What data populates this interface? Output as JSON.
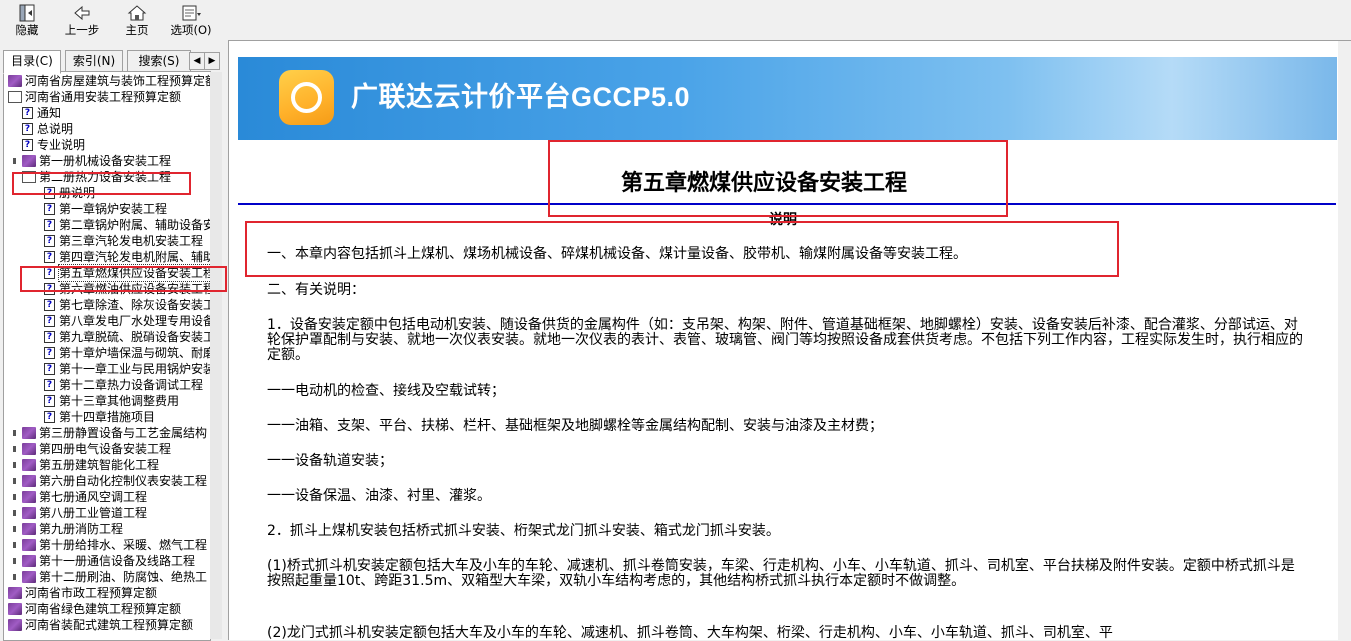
{
  "toolbar": {
    "buttons": [
      {
        "label": "隐藏",
        "icon": "hide-icon"
      },
      {
        "label": "上一步",
        "icon": "back-arrow-icon"
      },
      {
        "label": "主页",
        "icon": "home-icon"
      },
      {
        "label": "选项(O)",
        "icon": "options-icon"
      }
    ]
  },
  "tabs": [
    {
      "label": "目录(C)",
      "active": true
    },
    {
      "label": "索引(N)",
      "active": false
    },
    {
      "label": "搜索(S)",
      "active": false
    }
  ],
  "tree": [
    {
      "label": "河南省房屋建筑与装饰工程预算定额",
      "icon": "book-icon",
      "level": 0
    },
    {
      "label": "河南省通用安装工程预算定额",
      "icon": "open-book-icon",
      "level": 0
    },
    {
      "label": "通知",
      "icon": "help-page-icon",
      "level": 1
    },
    {
      "label": "总说明",
      "icon": "help-page-icon",
      "level": 1
    },
    {
      "label": "专业说明",
      "icon": "help-page-icon",
      "level": 1
    },
    {
      "label": "第一册机械设备安装工程",
      "icon": "book-icon",
      "level": 1
    },
    {
      "label": "第二册热力设备安装工程",
      "icon": "open-book-icon",
      "level": 1
    },
    {
      "label": "册说明",
      "icon": "help-page-icon",
      "level": 2
    },
    {
      "label": "第一章锅炉安装工程",
      "icon": "help-page-icon",
      "level": 2
    },
    {
      "label": "第二章锅炉附属、辅助设备安",
      "icon": "help-page-icon",
      "level": 2
    },
    {
      "label": "第三章汽轮发电机安装工程",
      "icon": "help-page-icon",
      "level": 2
    },
    {
      "label": "第四章汽轮发电机附属、辅助",
      "icon": "help-page-icon",
      "level": 2
    },
    {
      "label": "第五章燃煤供应设备安装工程",
      "icon": "help-page-icon",
      "level": 2,
      "selected": true
    },
    {
      "label": "第六章燃油供应设备安装工程",
      "icon": "help-page-icon",
      "level": 2
    },
    {
      "label": "第七章除渣、除灰设备安装工",
      "icon": "help-page-icon",
      "level": 2
    },
    {
      "label": "第八章发电厂水处理专用设备",
      "icon": "help-page-icon",
      "level": 2
    },
    {
      "label": "第九章脱硫、脱硝设备安装工",
      "icon": "help-page-icon",
      "level": 2
    },
    {
      "label": "第十章炉墙保温与砌筑、耐磨",
      "icon": "help-page-icon",
      "level": 2
    },
    {
      "label": "第十一章工业与民用锅炉安装",
      "icon": "help-page-icon",
      "level": 2
    },
    {
      "label": "第十二章热力设备调试工程",
      "icon": "help-page-icon",
      "level": 2
    },
    {
      "label": "第十三章其他调整费用",
      "icon": "help-page-icon",
      "level": 2
    },
    {
      "label": "第十四章措施项目",
      "icon": "help-page-icon",
      "level": 2
    },
    {
      "label": "第三册静置设备与工艺金属结构",
      "icon": "book-icon",
      "level": 1
    },
    {
      "label": "第四册电气设备安装工程",
      "icon": "book-icon",
      "level": 1
    },
    {
      "label": "第五册建筑智能化工程",
      "icon": "book-icon",
      "level": 1
    },
    {
      "label": "第六册自动化控制仪表安装工程",
      "icon": "book-icon",
      "level": 1
    },
    {
      "label": "第七册通风空调工程",
      "icon": "book-icon",
      "level": 1
    },
    {
      "label": "第八册工业管道工程",
      "icon": "book-icon",
      "level": 1
    },
    {
      "label": "第九册消防工程",
      "icon": "book-icon",
      "level": 1
    },
    {
      "label": "第十册给排水、采暖、燃气工程",
      "icon": "book-icon",
      "level": 1
    },
    {
      "label": "第十一册通信设备及线路工程",
      "icon": "book-icon",
      "level": 1
    },
    {
      "label": "第十二册刷油、防腐蚀、绝热工",
      "icon": "book-icon",
      "level": 1
    },
    {
      "label": "河南省市政工程预算定额",
      "icon": "book-icon",
      "level": 0
    },
    {
      "label": "河南省绿色建筑工程预算定额",
      "icon": "book-icon",
      "level": 0
    },
    {
      "label": "河南省装配式建筑工程预算定额",
      "icon": "book-icon",
      "level": 0
    }
  ],
  "banner": {
    "title": "广联达云计价平台GCCP5.0",
    "logo_icon": "glodon-logo-icon"
  },
  "doc": {
    "title": "第五章燃煤供应设备安装工程",
    "subhead": "说明",
    "paragraphs": [
      "一、本章内容包括抓斗上煤机、煤场机械设备、碎煤机械设备、煤计量设备、胶带机、输煤附属设备等安装工程。",
      "二、有关说明：",
      "1．设备安装定额中包括电动机安装、随设备供货的金属构件（如：支吊架、构架、附件、管道基础框架、地脚螺栓）安装、设备安装后补漆、配合灌浆、分部试运、对轮保护罩配制与安装、就地一次仪表安装。就地一次仪表的表计、表管、玻璃管、阀门等均按照设备成套供货考虑。不包括下列工作内容，工程实际发生时，执行相应的定额。",
      "一一电动机的检查、接线及空载试转；",
      "一一油箱、支架、平台、扶梯、栏杆、基础框架及地脚螺栓等金属结构配制、安装与油漆及主材费；",
      "一一设备轨道安装；",
      "一一设备保温、油漆、衬里、灌浆。",
      "2．抓斗上煤机安装包括桥式抓斗安装、桁架式龙门抓斗安装、箱式龙门抓斗安装。",
      "(1)桥式抓斗机安装定额包括大车及小车的车轮、减速机、抓斗卷筒安装，车梁、行走机构、小车、小车轨道、抓斗、司机室、平台扶梯及附件安装。定额中桥式抓斗是按照起重量10t、跨距31.5m、双箱型大车梁，双轨小车结构考虑的，其他结构桥式抓斗执行本定额时不做调整。",
      "(2)龙门式抓斗机安装定额包括大车及小车的车轮、减速机、抓斗卷筒、大车构架、桁梁、行走机构、小车、小车轨道、抓斗、司机室、平"
    ]
  },
  "colors": {
    "highlight_box": "#e0252f",
    "rule": "#0000c8",
    "banner": "#2a8ad8"
  }
}
